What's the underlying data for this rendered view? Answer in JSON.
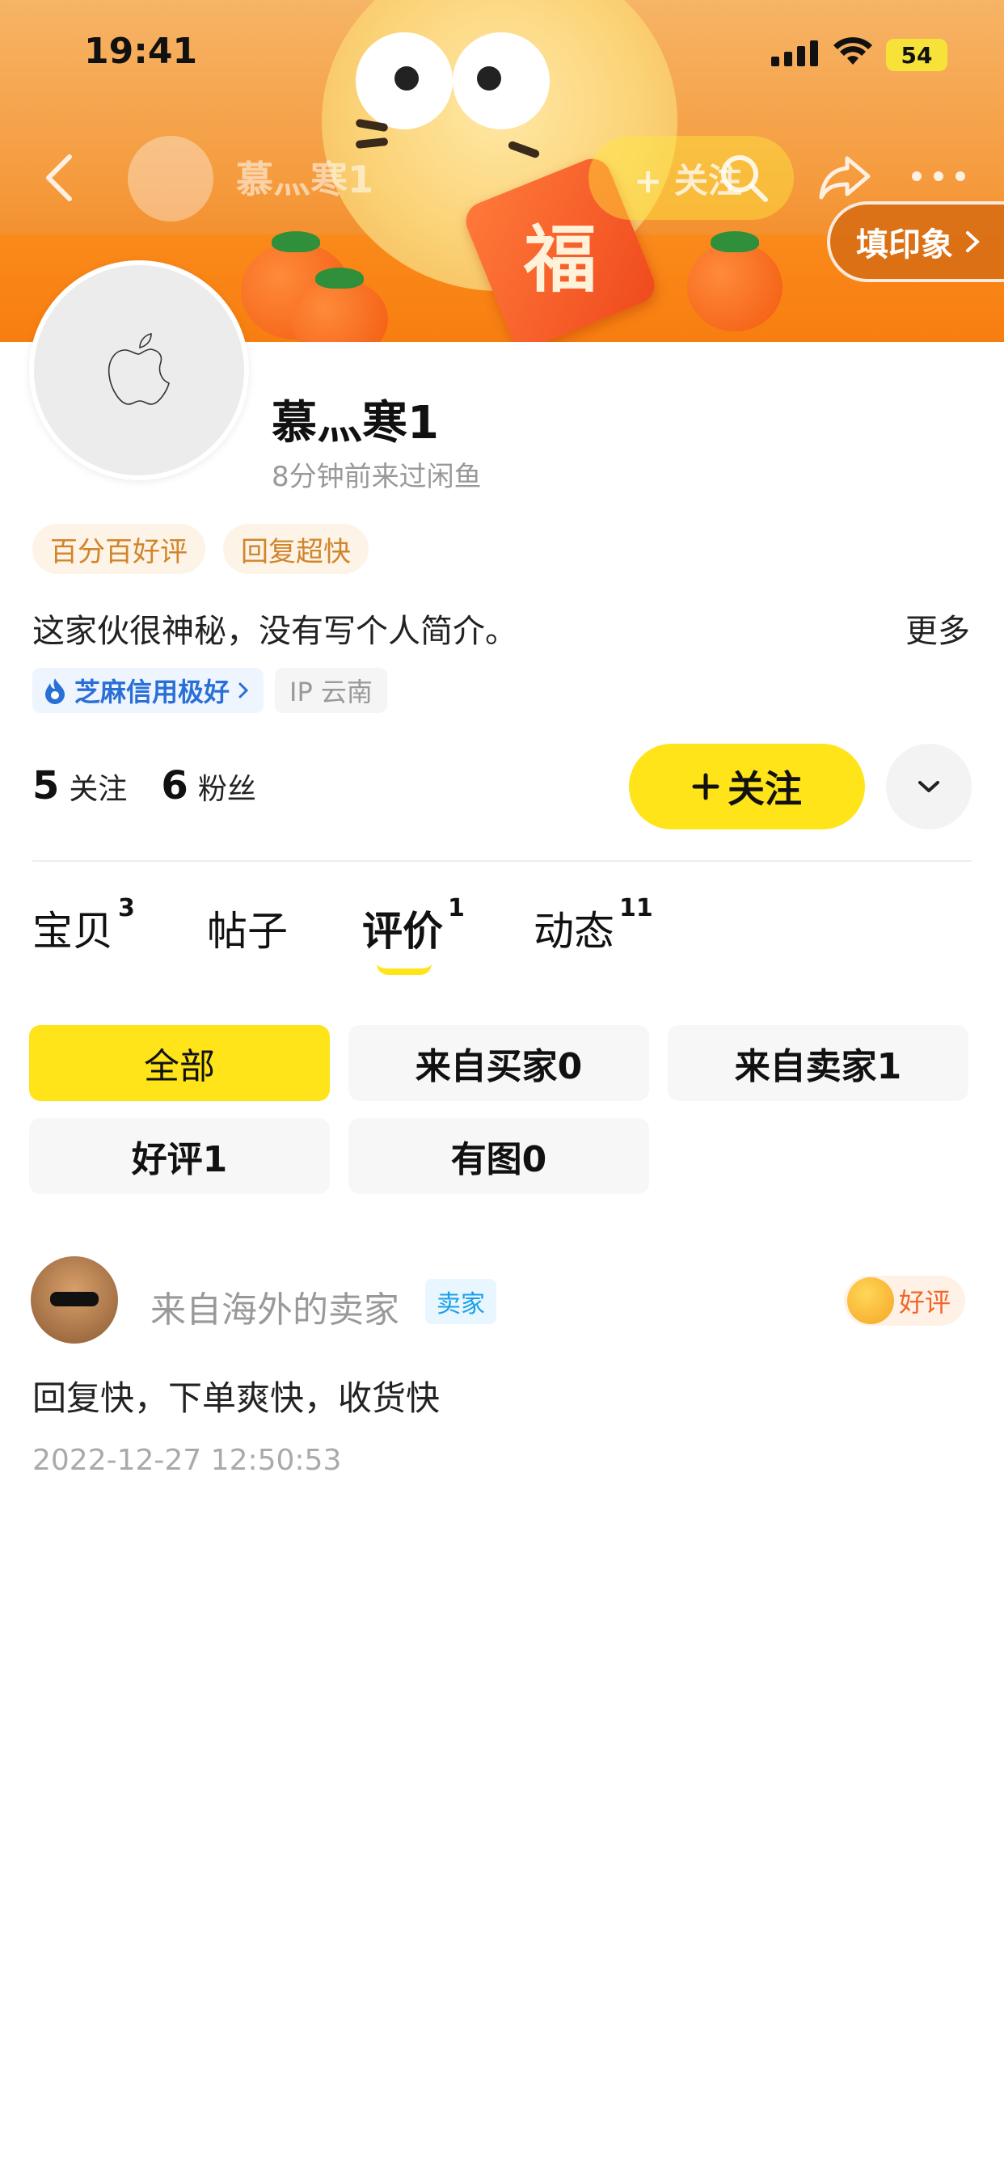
{
  "status_bar": {
    "time": "19:41",
    "battery": "54"
  },
  "nav": {
    "title": "慕灬寒1",
    "follow_label": "+ 关注",
    "impression_label": "填印象"
  },
  "banner": {
    "fu_char": "福"
  },
  "profile": {
    "name": "慕灬寒1",
    "last_seen": "8分钟前来过闲鱼",
    "tags": [
      "百分百好评",
      "回复超快"
    ],
    "bio": "这家伙很神秘，没有写个人简介。",
    "bio_more": "更多",
    "credit": "芝麻信用极好",
    "ip": "IP 云南",
    "following_count": "5",
    "following_label": "关注",
    "fans_count": "6",
    "fans_label": "粉丝",
    "follow_button": "关注"
  },
  "tabs": [
    {
      "label": "宝贝",
      "count": "3"
    },
    {
      "label": "帖子",
      "count": ""
    },
    {
      "label": "评价",
      "count": "1",
      "active": true
    },
    {
      "label": "动态",
      "count": "11"
    }
  ],
  "filters": [
    "全部",
    "来自买家0",
    "来自卖家1",
    "好评1",
    "有图0"
  ],
  "review": {
    "author": "来自海外的卖家",
    "role": "卖家",
    "rating": "好评",
    "text": "回复快，下单爽快，收货快",
    "time": "2022-12-27 12:50:53"
  },
  "colors": {
    "accent": "#ffe419",
    "tag_text": "#d0852a",
    "credit_blue": "#2a6fd6"
  }
}
